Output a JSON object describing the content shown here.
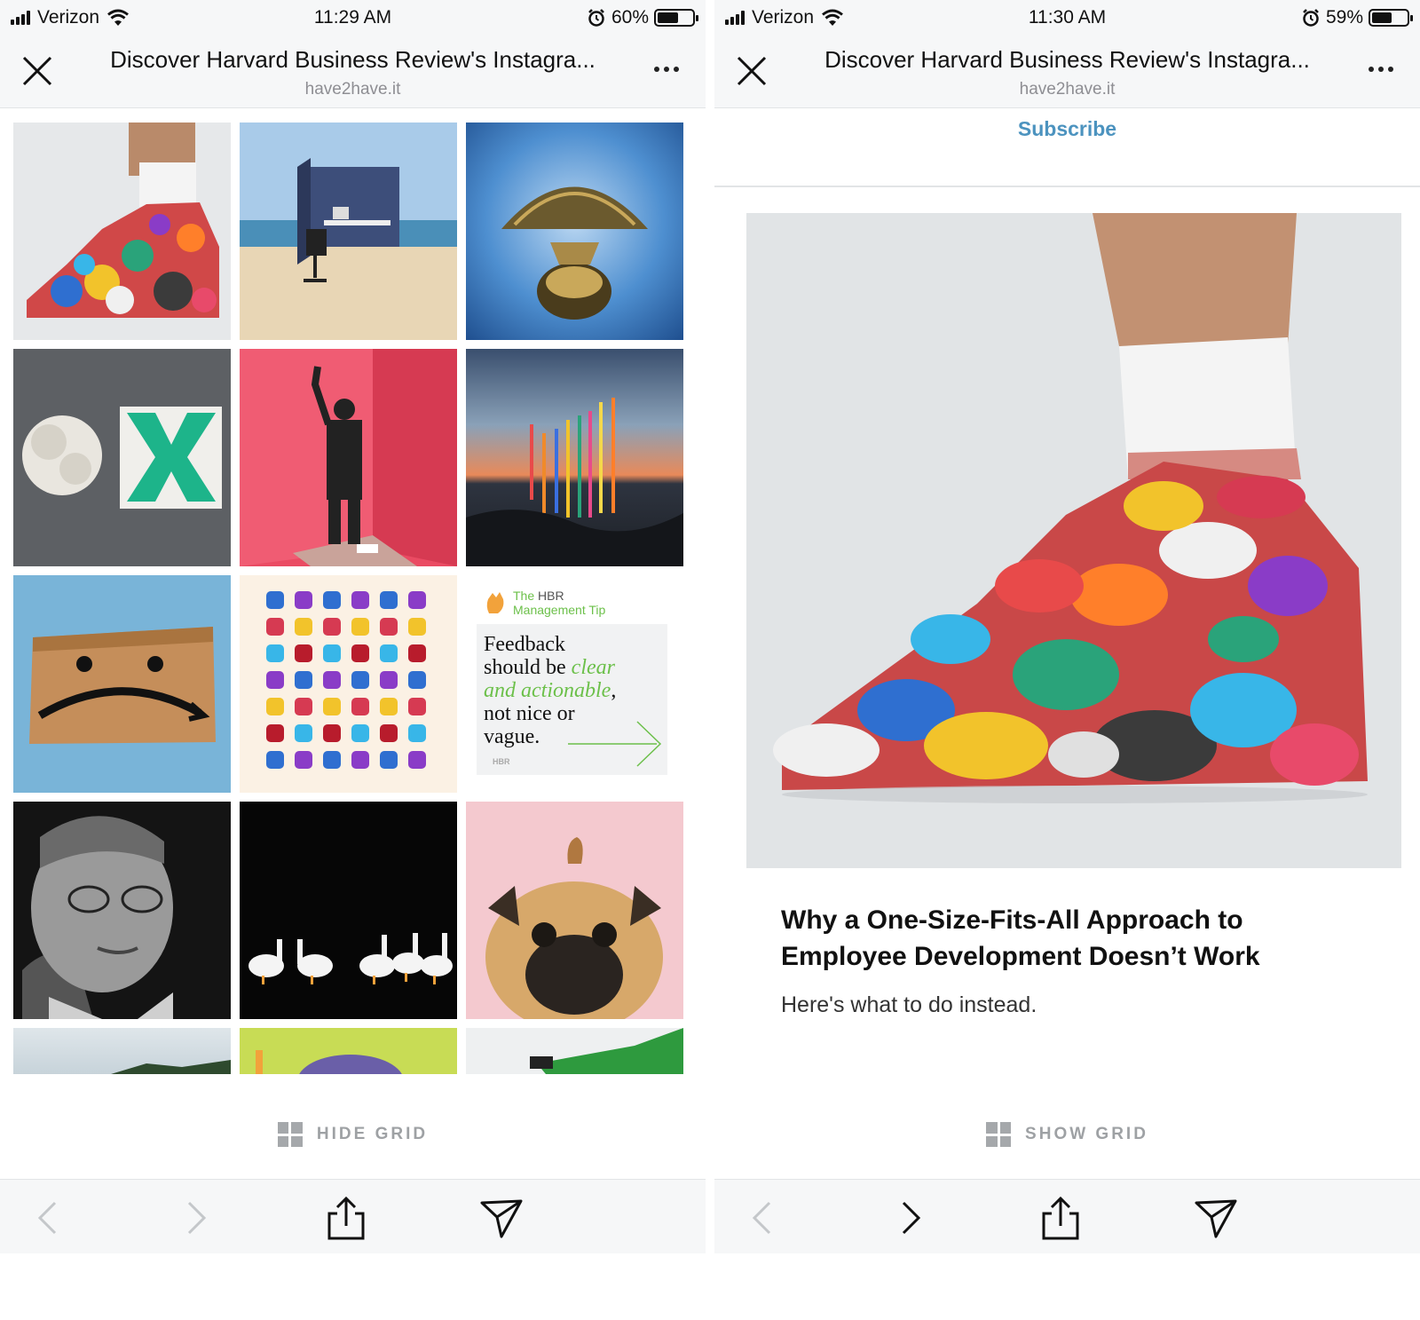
{
  "left": {
    "status": {
      "carrier": "Verizon",
      "time": "11:29 AM",
      "battery": "60%",
      "battery_level": 0.6
    },
    "nav": {
      "title": "Discover Harvard Business Review's Instagra...",
      "domain": "have2have.it"
    },
    "grid_toggle_label": "HIDE GRID",
    "tip_card": {
      "brand_prefix": "The ",
      "brand_name": "HBR",
      "brand_line2": "Management Tip",
      "text_1": "Feedback",
      "text_2": "should be ",
      "text_3": "clear",
      "text_4": "and actionable",
      "text_5": ",",
      "text_6": "not nice or",
      "text_7": "vague.",
      "footer_mark": "HBR"
    }
  },
  "right": {
    "status": {
      "carrier": "Verizon",
      "time": "11:30 AM",
      "battery": "59%",
      "battery_level": 0.59
    },
    "nav": {
      "title": "Discover Harvard Business Review's Instagra...",
      "domain": "have2have.it"
    },
    "subscribe_label": "Subscribe",
    "article": {
      "title": "Why a One-Size-Fits-All Approach to Employee Development Doesn’t Work",
      "subtitle": "Here's what to do instead."
    },
    "grid_toggle_label": "SHOW GRID"
  },
  "colors": {
    "accent": "#4c93bf",
    "toggle_gray": "#9ea1a4",
    "bar_bg": "#f6f7f8",
    "tip_green": "#6cc04a"
  },
  "icons": [
    "close-icon",
    "more-icon",
    "wifi-icon",
    "alarm-icon",
    "back-icon",
    "forward-icon",
    "share-icon",
    "send-icon",
    "grid-icon"
  ]
}
